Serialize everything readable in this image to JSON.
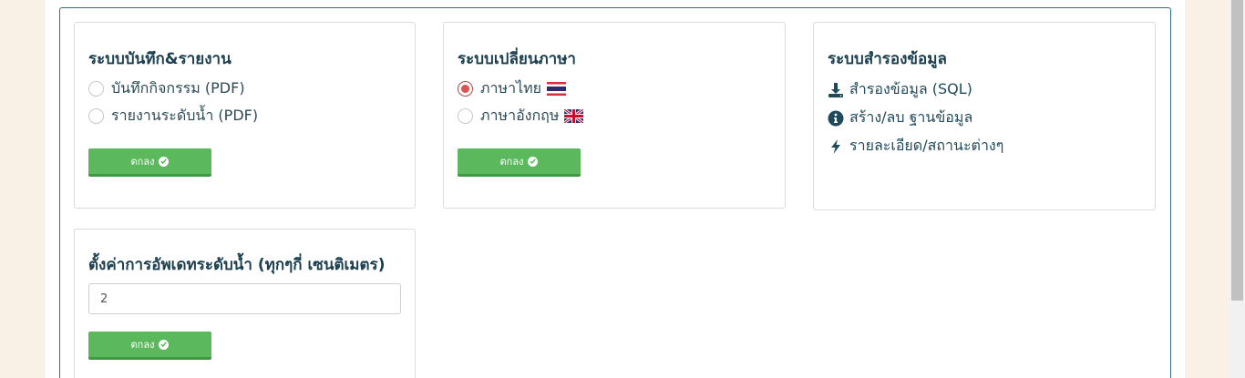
{
  "report_card": {
    "title": "ระบบบันทึก&รายงาน",
    "options": [
      {
        "label": "บันทึกกิจกรรม (PDF)",
        "checked": false
      },
      {
        "label": "รายงานระดับน้ำ (PDF)",
        "checked": false
      }
    ],
    "button_label": "ตกลง"
  },
  "language_card": {
    "title": "ระบบเปลี่ยนภาษา",
    "options": [
      {
        "label": "ภาษาไทย",
        "checked": true,
        "flag": "thai-flag-icon"
      },
      {
        "label": "ภาษาอังกฤษ",
        "checked": false,
        "flag": "uk-flag-icon"
      }
    ],
    "button_label": "ตกลง"
  },
  "backup_card": {
    "title": "ระบบสำรองข้อมูล",
    "links": [
      {
        "label": "สำรองข้อมูล (SQL)",
        "icon": "download-icon"
      },
      {
        "label": "สร้าง/ลบ ฐานข้อมูล",
        "icon": "info-icon"
      },
      {
        "label": "รายละเอียด/สถานะต่างๆ",
        "icon": "bolt-icon"
      }
    ]
  },
  "update_card": {
    "title": "ตั้งค่าการอัพเดทระดับน้ำ (ทุกๆกี่ เซนติเมตร)",
    "input_value": "2",
    "button_label": "ตกลง"
  },
  "colors": {
    "button": "#5cb85c",
    "accent_border": "#2f6f8a",
    "page_bg": "#faf1e6",
    "radio_checked": "#d9534f"
  }
}
